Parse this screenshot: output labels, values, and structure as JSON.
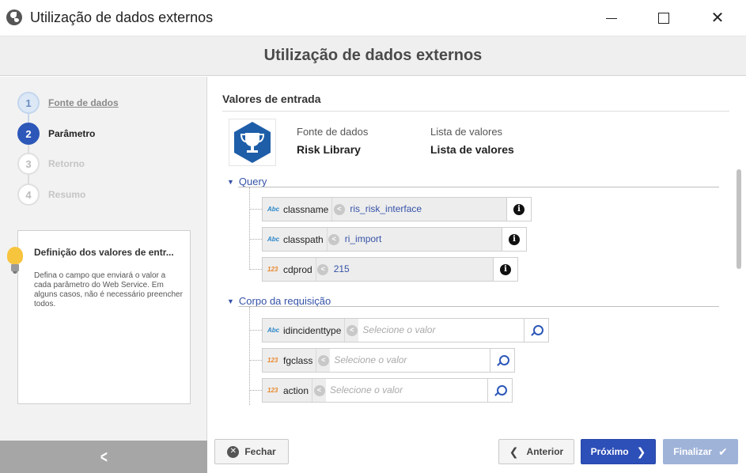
{
  "window": {
    "title": "Utilização de dados externos",
    "icons": {
      "app": "globe-icon",
      "minimize": "minimize-icon",
      "maximize": "maximize-icon",
      "close": "close-icon"
    }
  },
  "header": {
    "title": "Utilização de dados externos"
  },
  "sidebar": {
    "steps": [
      {
        "number": "1",
        "label": "Fonte de dados",
        "state": "done"
      },
      {
        "number": "2",
        "label": "Parâmetro",
        "state": "active"
      },
      {
        "number": "3",
        "label": "Retorno",
        "state": "pending"
      },
      {
        "number": "4",
        "label": "Resumo",
        "state": "pending"
      }
    ],
    "info": {
      "title": "Definição dos valores de entr...",
      "text": "Defina o campo que enviará o valor a cada parâmetro do Web Service. Em alguns casos, não é necessário preencher todos.",
      "icon": "lightbulb-icon"
    },
    "collapse_icon": "chevron-left-icon",
    "collapse_glyph": "<"
  },
  "main": {
    "section_title": "Valores de entrada",
    "source": {
      "icon": "trophy-icon",
      "datasource_label": "Fonte de dados",
      "datasource_value": "Risk Library",
      "list_label": "Lista de valores",
      "list_value": "Lista de valores"
    },
    "query": {
      "title": "Query",
      "fields": [
        {
          "type": "Abc",
          "name": "classname",
          "value": "ris_risk_interface",
          "action": "info-icon"
        },
        {
          "type": "Abc",
          "name": "classpath",
          "value": "ri_import",
          "action": "info-icon"
        },
        {
          "type": "123",
          "name": "cdprod",
          "value": "215",
          "action": "info-icon"
        }
      ]
    },
    "body": {
      "title": "Corpo da requisição",
      "fields": [
        {
          "type": "Abc",
          "name": "idincidenttype",
          "placeholder": "Selecione o valor",
          "action": "search-icon"
        },
        {
          "type": "123",
          "name": "fgclass",
          "placeholder": "Selecione o valor",
          "action": "search-icon"
        },
        {
          "type": "123",
          "name": "action",
          "placeholder": "Selecione o valor",
          "action": "search-icon"
        }
      ]
    },
    "glyphs": {
      "caret": "▼",
      "arrow": "<",
      "info": "i"
    }
  },
  "footer": {
    "close_label": "Fechar",
    "prev_label": "Anterior",
    "next_label": "Próximo",
    "finish_label": "Finalizar",
    "glyphs": {
      "x": "✕",
      "prev": "❮",
      "next": "❯",
      "check": "✔"
    }
  },
  "colors": {
    "accent": "#2d4fb8",
    "link": "#3552a8",
    "finish_disabled": "#9fb3d8",
    "trophy_bg": "#1e5ea8",
    "text_type": "#2a86c9",
    "num_type": "#e8882e"
  }
}
